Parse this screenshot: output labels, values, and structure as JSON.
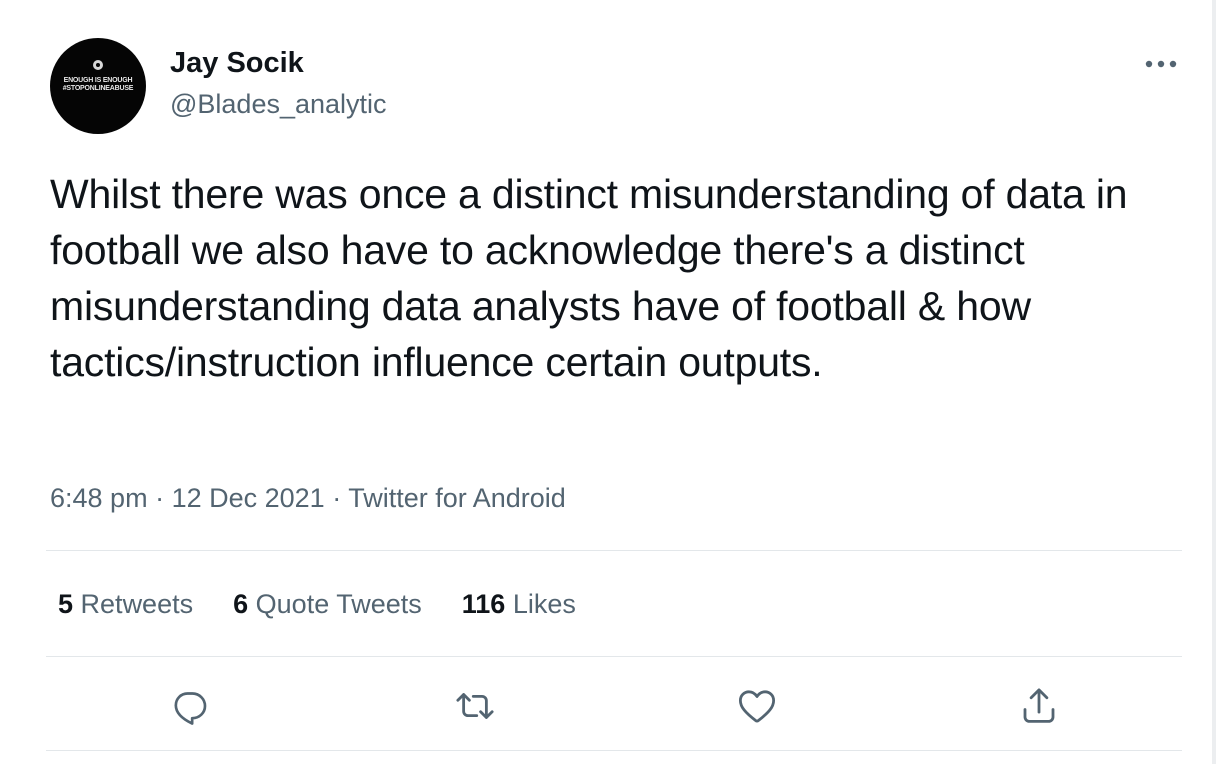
{
  "author": {
    "display_name": "Jay Socik",
    "handle": "@Blades_analytic",
    "avatar_text": {
      "line1": "ENOUGH IS ENOUGH",
      "line2": "#STOPONLINEABUSE"
    }
  },
  "tweet": {
    "text": "Whilst there was once a distinct misunderstanding of data in football we also have to acknowledge there's a distinct misunderstanding data analysts have of football & how tactics/instruction influence certain outputs.",
    "time": "6:48 pm",
    "separator1": " · ",
    "date": "12 Dec 2021",
    "separator2": " · ",
    "source": "Twitter for Android"
  },
  "stats": {
    "retweets": {
      "count": "5",
      "label": "Retweets"
    },
    "quote_tweets": {
      "count": "6",
      "label": "Quote Tweets"
    },
    "likes": {
      "count": "116",
      "label": "Likes"
    }
  },
  "icons": {
    "more": "more-horizontal-icon",
    "reply": "reply-icon",
    "retweet": "retweet-icon",
    "like": "heart-icon",
    "share": "share-icon"
  },
  "colors": {
    "text_primary": "#0f1419",
    "text_secondary": "#536471",
    "divider": "#e3e7ea"
  }
}
